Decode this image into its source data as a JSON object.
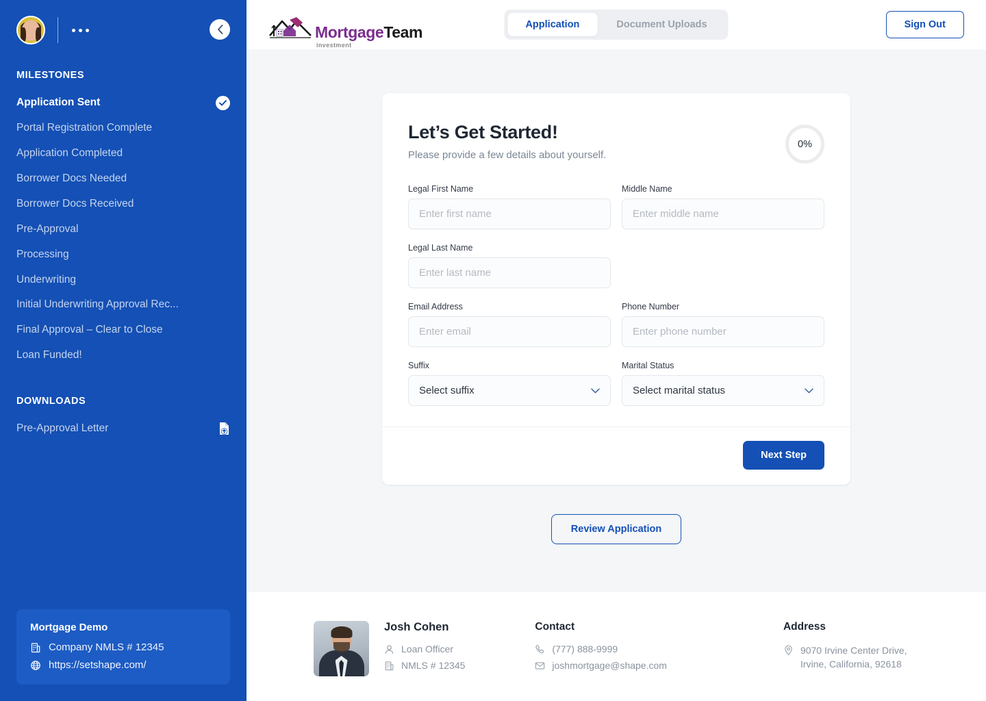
{
  "sidebar": {
    "avatar_alt": "user-avatar",
    "menu_dots_label": "...",
    "collapse_label": "collapse-sidebar",
    "milestones_title": "MILESTONES",
    "milestones": [
      {
        "label": "Application Sent",
        "complete": true
      },
      {
        "label": "Portal Registration Complete",
        "complete": false
      },
      {
        "label": "Application Completed",
        "complete": false
      },
      {
        "label": "Borrower Docs Needed",
        "complete": false
      },
      {
        "label": "Borrower Docs Received",
        "complete": false
      },
      {
        "label": "Pre-Approval",
        "complete": false
      },
      {
        "label": "Processing",
        "complete": false
      },
      {
        "label": "Underwriting",
        "complete": false
      },
      {
        "label": "Initial Underwriting Approval Rec...",
        "complete": false
      },
      {
        "label": "Final Approval – Clear to Close",
        "complete": false
      },
      {
        "label": "Loan Funded!",
        "complete": false
      }
    ],
    "downloads_title": "DOWNLOADS",
    "downloads": [
      {
        "label": "Pre-Approval Letter"
      }
    ],
    "company": {
      "name": "Mortgage Demo",
      "nmls": "Company NMLS # 12345",
      "website": "https://setshape.com/"
    }
  },
  "topbar": {
    "logo": {
      "part1": "Mortgage",
      "part2": "Team",
      "subtitle": "investment"
    },
    "tabs": [
      {
        "label": "Application",
        "active": true
      },
      {
        "label": "Document Uploads",
        "active": false
      }
    ],
    "sign_out_label": "Sign Out"
  },
  "form": {
    "title": "Let’s Get Started!",
    "subtitle": "Please provide a few details about yourself.",
    "progress": "0%",
    "fields": {
      "first_name": {
        "label": "Legal First Name",
        "placeholder": "Enter first name",
        "value": ""
      },
      "middle_name": {
        "label": "Middle Name",
        "placeholder": "Enter middle name",
        "value": ""
      },
      "last_name": {
        "label": "Legal Last Name",
        "placeholder": "Enter last name",
        "value": ""
      },
      "email": {
        "label": "Email Address",
        "placeholder": "Enter email",
        "value": ""
      },
      "phone": {
        "label": "Phone Number",
        "placeholder": "Enter phone number",
        "value": ""
      },
      "suffix": {
        "label": "Suffix",
        "placeholder": "Select suffix",
        "value": ""
      },
      "marital_status": {
        "label": "Marital Status",
        "placeholder": "Select marital status",
        "value": ""
      }
    },
    "next_step_label": "Next Step",
    "review_label": "Review Application"
  },
  "footer": {
    "officer": {
      "name": "Josh Cohen",
      "role": "Loan Officer",
      "nmls": "NMLS # 12345"
    },
    "contact": {
      "title": "Contact",
      "phone": "(777) 888-9999",
      "email": "joshmortgage@shape.com"
    },
    "address": {
      "title": "Address",
      "line1": "9070 Irvine Center Drive,",
      "line2": "Irvine, California, 92618"
    }
  },
  "colors": {
    "brand_blue": "#1450B5",
    "sidebar_blue": "#1450B5",
    "logo_purple": "#7B2E8E",
    "page_bg": "#F4F6F8"
  }
}
